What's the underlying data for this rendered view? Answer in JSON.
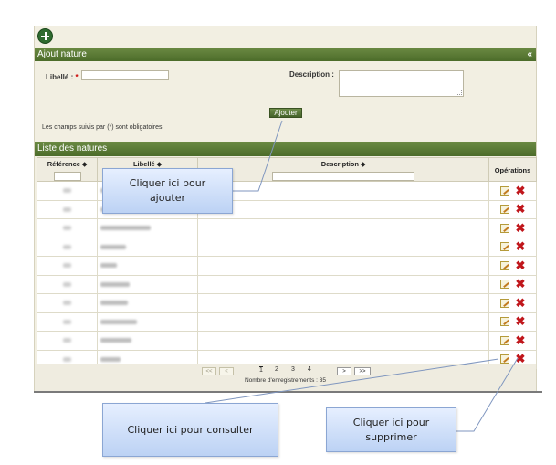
{
  "form": {
    "section_title": "Ajout nature",
    "collapse_glyph": "«",
    "libelle_label": "Libellé :",
    "required_mark": "*",
    "libelle_value": "",
    "description_label": "Description :",
    "description_value": "",
    "submit_label": "Ajouter",
    "required_note": "Les champs suivis par (*) sont obligatoires."
  },
  "list": {
    "section_title": "Liste des natures",
    "columns": {
      "reference": "Référence ⬥",
      "libelle": "Libellé ⬥",
      "description": "Description ⬥",
      "operations": "Opérations"
    },
    "rows": [
      {
        "reference": "",
        "libelle": "",
        "description": ""
      },
      {
        "reference": "",
        "libelle": "",
        "description": ""
      },
      {
        "reference": "",
        "libelle": "",
        "description": ""
      },
      {
        "reference": "",
        "libelle": "",
        "description": ""
      },
      {
        "reference": "",
        "libelle": "",
        "description": ""
      },
      {
        "reference": "",
        "libelle": "",
        "description": ""
      },
      {
        "reference": "",
        "libelle": "",
        "description": ""
      },
      {
        "reference": "",
        "libelle": "",
        "description": ""
      },
      {
        "reference": "",
        "libelle": "",
        "description": ""
      },
      {
        "reference": "",
        "libelle": "",
        "description": ""
      }
    ]
  },
  "pagination": {
    "first": "<<",
    "prev": "<",
    "pages": [
      "1",
      "2",
      "3",
      "4"
    ],
    "next": ">",
    "last": ">>",
    "record_count": "Nombre d'enregistrements : 35"
  },
  "callouts": {
    "ajouter": "Cliquer  ici pour ajouter",
    "consulter": "Cliquer ici pour consulter",
    "supprimer": "Cliquer  ici pour supprimer"
  },
  "colors": {
    "header_green": "#4c6c2a",
    "panel_bg": "#f2efe2",
    "delete_red": "#c0161b",
    "callout_blue": "#bcd2f4"
  }
}
